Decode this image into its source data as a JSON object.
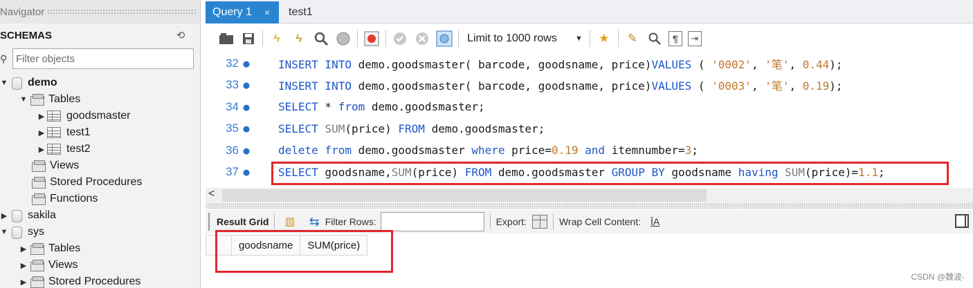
{
  "navigator": {
    "title": "Navigator",
    "schemas_label": "SCHEMAS",
    "filter_placeholder": "Filter objects",
    "tree": [
      {
        "label": "demo",
        "icon": "database-icon",
        "expanded": true
      },
      {
        "label": "Tables",
        "icon": "folder-icon",
        "expanded": true
      },
      {
        "label": "goodsmaster",
        "icon": "table-icon"
      },
      {
        "label": "test1",
        "icon": "table-icon"
      },
      {
        "label": "test2",
        "icon": "table-icon"
      },
      {
        "label": "Views",
        "icon": "folder-icon"
      },
      {
        "label": "Stored Procedures",
        "icon": "folder-icon"
      },
      {
        "label": "Functions",
        "icon": "folder-icon"
      },
      {
        "label": "sakila",
        "icon": "database-icon",
        "expanded": false
      },
      {
        "label": "sys",
        "icon": "database-icon",
        "expanded": true
      },
      {
        "label": "Tables",
        "icon": "folder-icon"
      },
      {
        "label": "Views",
        "icon": "folder-icon"
      },
      {
        "label": "Stored Procedures",
        "icon": "folder-icon"
      }
    ]
  },
  "tabs": [
    {
      "label": "Query 1",
      "active": true,
      "close": "×"
    },
    {
      "label": "test1",
      "active": false
    }
  ],
  "toolbar": {
    "limit_label": "Limit to 1000 rows"
  },
  "editor": {
    "lines": [
      {
        "num": "32",
        "tokens": [
          [
            "kw",
            "INSERT INTO "
          ],
          [
            "",
            "demo.goodsmaster( barcode, goodsname, price)"
          ],
          [
            "kw",
            "VALUES"
          ],
          [
            "",
            " ( "
          ],
          [
            "str",
            "'0002'"
          ],
          [
            "",
            ", "
          ],
          [
            "str",
            "'笔'"
          ],
          [
            "",
            ", "
          ],
          [
            "num",
            "0.44"
          ],
          [
            "",
            ");"
          ]
        ]
      },
      {
        "num": "33",
        "tokens": [
          [
            "kw",
            "INSERT INTO "
          ],
          [
            "",
            "demo.goodsmaster( barcode, goodsname, price)"
          ],
          [
            "kw",
            "VALUES"
          ],
          [
            "",
            " ( "
          ],
          [
            "str",
            "'0003'"
          ],
          [
            "",
            ", "
          ],
          [
            "str",
            "'笔'"
          ],
          [
            "",
            ", "
          ],
          [
            "num",
            "0.19"
          ],
          [
            "",
            ");"
          ]
        ]
      },
      {
        "num": "34",
        "tokens": [
          [
            "kw",
            "SELECT"
          ],
          [
            "",
            " * "
          ],
          [
            "kw",
            "from"
          ],
          [
            "",
            " demo.goodsmaster;"
          ]
        ]
      },
      {
        "num": "35",
        "tokens": [
          [
            "kw",
            "SELECT "
          ],
          [
            "fn",
            "SUM"
          ],
          [
            "",
            "(price) "
          ],
          [
            "kw",
            "FROM"
          ],
          [
            "",
            " demo.goodsmaster;"
          ]
        ]
      },
      {
        "num": "36",
        "tokens": [
          [
            "kw",
            "delete from"
          ],
          [
            "",
            " demo.goodsmaster "
          ],
          [
            "kw",
            "where"
          ],
          [
            "",
            " price="
          ],
          [
            "num",
            "0.19"
          ],
          [
            "",
            " "
          ],
          [
            "kw",
            "and"
          ],
          [
            "",
            " itemnumber="
          ],
          [
            "num",
            "3"
          ],
          [
            "",
            ";"
          ]
        ]
      },
      {
        "num": "37",
        "tokens": [
          [
            "kw",
            "SELECT"
          ],
          [
            "",
            " goodsname,"
          ],
          [
            "fn",
            "SUM"
          ],
          [
            "",
            "(price) "
          ],
          [
            "kw",
            "FROM"
          ],
          [
            "",
            " demo.goodsmaster "
          ],
          [
            "kw",
            "GROUP BY"
          ],
          [
            "",
            " goodsname "
          ],
          [
            "kw",
            "having"
          ],
          [
            "",
            " "
          ],
          [
            "fn",
            "SUM"
          ],
          [
            "",
            "(price)="
          ],
          [
            "num",
            "1.1"
          ],
          [
            "",
            ";"
          ]
        ]
      }
    ]
  },
  "scroll": {
    "left_arrow": "<"
  },
  "result": {
    "grid_label": "Result Grid",
    "filter_rows_label": "Filter Rows:",
    "export_label": "Export:",
    "wrap_label": "Wrap Cell Content:",
    "wrap_icon_glyph": "ĪA",
    "columns": [
      "goodsname",
      "SUM(price)"
    ]
  },
  "watermark": "CSDN @魏波-",
  "colors": {
    "accent": "#2a85d1",
    "highlight_box": "#e2262b",
    "keyword": "#1d57c9",
    "string": "#c0782c"
  }
}
